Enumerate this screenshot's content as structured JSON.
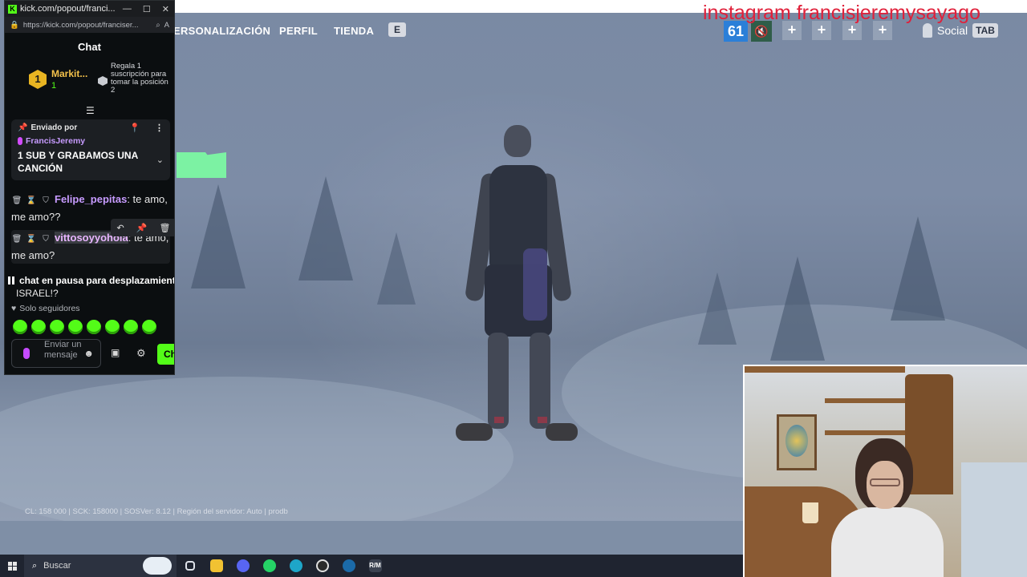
{
  "browser_window": {
    "title": "kick.com/popout/franci...",
    "url": "https://kick.com/popout/franciser...",
    "controls": [
      "—",
      "☐",
      "✕"
    ]
  },
  "chat": {
    "header": "Chat",
    "leaderboard": {
      "rank": "1",
      "name": "Markit...",
      "count": "1",
      "gift_text": "Regala 1 suscripción para tomar la posición 2"
    },
    "pinned": {
      "label": "Enviado por",
      "author": "FrancisJeremy",
      "message": "1 SUB Y GRABAMOS UNA CANCIÓN"
    },
    "messages": [
      {
        "user": "Felipe_pepitas",
        "user_color": "#c79bff",
        "text": ": te amo, me amo??"
      },
      {
        "user": "vittosoyyohola",
        "user_color": "#e8b5ff",
        "text": ": te amo, me amo?"
      }
    ],
    "paused_text": "chat en pausa para desplazamiento",
    "behind_message": "ISRAEL!?",
    "followers_only": "Solo seguidores",
    "emote_count": 8,
    "input_placeholder": "Enviar un mensaje",
    "send_label": "Ch"
  },
  "game": {
    "nav": [
      "ERSONALIZACIÓN",
      "PERFIL",
      "TIENDA"
    ],
    "key_hint": "E",
    "level": "61",
    "social_label": "Social",
    "social_key": "TAB",
    "party_slots": [
      "+",
      "+",
      "+",
      "+"
    ],
    "debug": "CL: 158 000 | SCK: 158000 | SOSVer: 8.12 | Región del servidor: Auto | prodb"
  },
  "overlay": {
    "watermark": "instagram francisjeremysayago",
    "watermark_color": "#e0203a"
  },
  "taskbar": {
    "search_placeholder": "Buscar",
    "apps": [
      "task-view-icon",
      "file-explorer-icon",
      "discord-icon",
      "whatsapp-icon",
      "edge-icon",
      "obs-icon",
      "steam-icon",
      "rm-icon"
    ]
  },
  "colors": {
    "kick_green": "#53fc18",
    "accent_gold": "#f4c14b"
  }
}
